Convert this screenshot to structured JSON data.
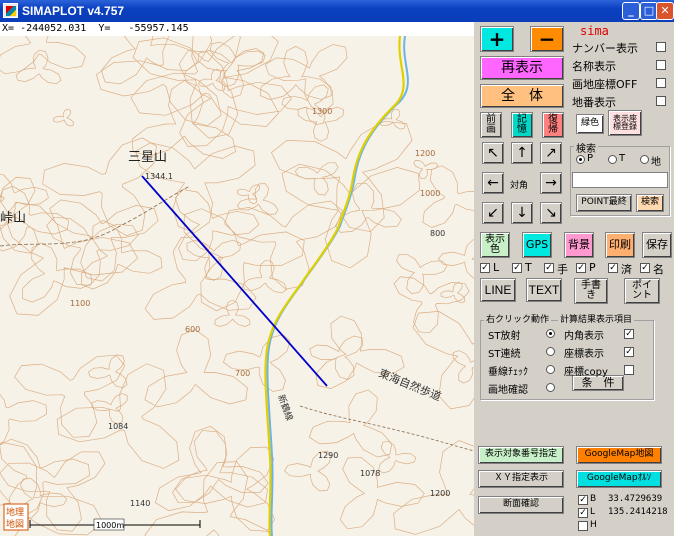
{
  "window": {
    "title": "SIMAPLOT v4.757",
    "min": "_",
    "max": "□",
    "close": "✕"
  },
  "coords": {
    "x_label": "X=",
    "x_value": "-244052.031",
    "y_label": "Y=",
    "y_value": "-55957.145"
  },
  "map": {
    "labels": {
      "peak": "三星山",
      "peak_elev": "1344.1",
      "left_peak": "峠山",
      "contour1": "1300",
      "contour2": "1200",
      "contour3": "1000",
      "contour4": "1100",
      "contour5": "600",
      "contour6": "700",
      "pt1": "1084",
      "pt2": "1078",
      "pt3": "1290",
      "pt4": "1140",
      "pt5": "1200",
      "pt6": "800",
      "trail": "東海自然歩道",
      "road_label": "新鶴線"
    },
    "chizu_badge": "地理\n地図",
    "scale_text": "1000m"
  },
  "panel": {
    "plus": "+",
    "minus": "−",
    "redisplay": "再表示",
    "overall": "全　体",
    "prev": "前\n画",
    "memory": "記\n憶",
    "restore": "復\n帰",
    "green": "緑色",
    "show_coord": "表示座\n標登録",
    "arrows": {
      "nw": "↖",
      "n": "↑",
      "ne": "↗",
      "w": "←",
      "center": "対角",
      "e": "→",
      "sw": "↙",
      "s": "↓",
      "se": "↘"
    },
    "sima": {
      "title": "sima",
      "items": [
        {
          "label": "ナンバー表示",
          "checked": false
        },
        {
          "label": "名称表示",
          "checked": false
        },
        {
          "label": "画地座標OFF",
          "checked": false
        },
        {
          "label": "地番表示",
          "checked": false
        }
      ]
    },
    "search": {
      "title": "検索",
      "options": [
        "P",
        "T",
        "地"
      ],
      "selected": "P",
      "input": "",
      "point_last": "POINT最終",
      "search_btn": "検索"
    },
    "row_btns": {
      "display_color": "表示\n色",
      "gps": "GPS",
      "background": "背景",
      "print": "印刷",
      "save": "保存"
    },
    "layer_checks": [
      {
        "label": "L",
        "checked": true
      },
      {
        "label": "T",
        "checked": true
      },
      {
        "label": "手",
        "checked": true
      },
      {
        "label": "P",
        "checked": true
      },
      {
        "label": "済",
        "checked": true
      },
      {
        "label": "名",
        "checked": true
      }
    ],
    "tools": {
      "line": "LINE",
      "text": "TEXT",
      "handwrite": "手書\nき",
      "point": "ポイ\nント"
    },
    "right_click": {
      "title": "右クリック動作",
      "calc_title": "計算結果表示項目",
      "items": [
        {
          "label": "ST放射",
          "on": true
        },
        {
          "label": "ST連続",
          "on": false
        },
        {
          "label": "垂線ﾁｪｯｸ",
          "on": false
        },
        {
          "label": "画地確認",
          "on": false
        }
      ],
      "calc_items": [
        {
          "label": "内角表示",
          "checked": true
        },
        {
          "label": "座標表示",
          "checked": true
        },
        {
          "label": "座標copy",
          "checked": false
        }
      ],
      "condition": "条　件"
    },
    "bottom": {
      "target_no": "表示対象番号指定",
      "xy_display": "ＸＹ指定表示",
      "section": "断面確認",
      "gmap": "GoogleMap地図",
      "gmap_ortho": "GoogleMapｵﾙｿ",
      "B": {
        "label": "B",
        "checked": true,
        "value": "33.4729639"
      },
      "L": {
        "label": "L",
        "checked": true,
        "value": "135.2414218"
      },
      "H": {
        "label": "H",
        "checked": false
      }
    }
  },
  "colors": {
    "plus_bg": "#00e8e0",
    "minus_bg": "#ff8c00",
    "redisplay_bg": "#ff66ff",
    "overall_bg": "#ffc080",
    "line_color": "#0000cc"
  }
}
